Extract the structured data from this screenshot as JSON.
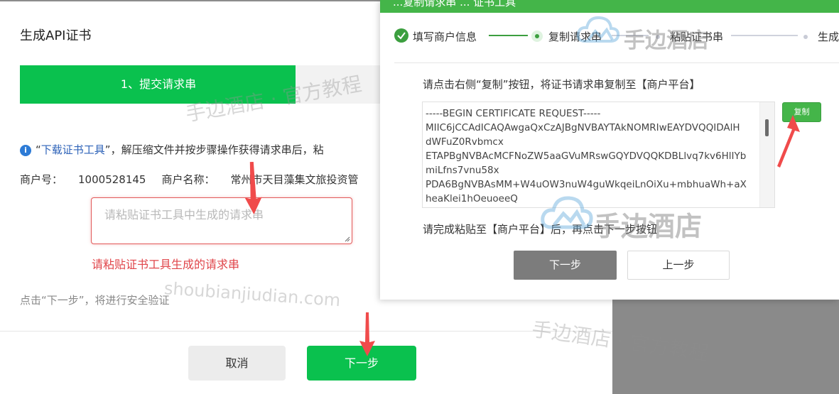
{
  "left_dialog": {
    "title": "生成API证书",
    "step_banner": "1、提交请求串",
    "info": {
      "quote_open": "“",
      "tool_link": "下载证书工具",
      "rest": "”，解压缩文件并按步骤操作获得请求串后，粘"
    },
    "merchant": {
      "id_label": "商户号：",
      "id_value": "1000528145",
      "name_label": "商户名称：",
      "name_value": "常州市天目藻集文旅投资管"
    },
    "request_input": {
      "placeholder": "请粘贴证书工具中生成的请求串",
      "value": ""
    },
    "error_text": "请粘贴证书工具生成的请求串",
    "verify_hint": "点击“下一步”，将进行安全验证",
    "buttons": {
      "cancel": "取消",
      "next": "下一步"
    }
  },
  "right_dialog": {
    "header_text": "...复制请求串 ... 证书工具",
    "steps": [
      {
        "label": "填写商户信息",
        "state": "done"
      },
      {
        "label": "复制请求串",
        "state": "current"
      },
      {
        "label": "粘贴证书串",
        "state": "pending"
      },
      {
        "label": "生成证书",
        "state": "pending"
      }
    ],
    "copy_instruction": "请点击右侧“复制”按钮，将证书请求串复制至【商户平台】",
    "cert_lines": [
      "-----BEGIN CERTIFICATE REQUEST-----",
      "MIIC6jCCAdICAQAwgaQxCzAJBgNVBAYTAkNOMRIwEAYDVQQIDAlH",
      "dWFuZ0Rvbmcx",
      "ETAPBgNVBAcMCFNoZW5aaGVuMRswGQYDVQQKDBLlvq7kv6HlIYb",
      "miLfns7vnu58x",
      "PDA6BgNVBAsMM+W4uOW3nuW4guWkqeiLnOiXu+mbhuaWh+aX",
      "heaKlei1hOeuoeeQ"
    ],
    "copy_button": "复制",
    "paste_instruction": "请完成粘贴至【商户平台】后，再点击下一步按钮",
    "buttons": {
      "next": "下一步",
      "prev": "上一步"
    }
  },
  "watermarks": {
    "diag1": "手边酒店 · 官方教程",
    "url": "shoubianjiudian.com",
    "diag2": "手边酒店 · 官方教程",
    "brand1": "手边酒店",
    "brand2": "手边酒店"
  },
  "colors": {
    "primary_green": "#0ac14e",
    "step_green": "#3c9f3f",
    "copy_green": "#44b549",
    "error_red": "#e0454a",
    "link_blue": "#2d62b8",
    "arrow_red": "#f04b4b"
  }
}
